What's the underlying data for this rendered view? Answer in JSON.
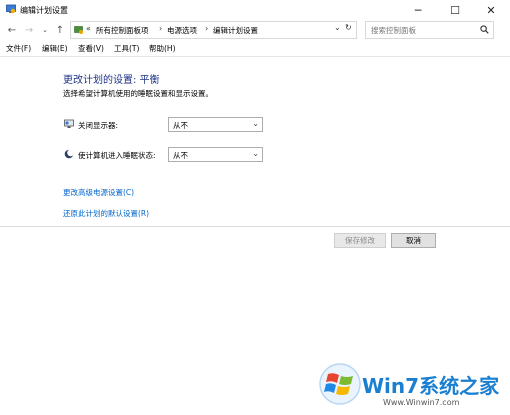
{
  "window": {
    "title": "编辑计划设置",
    "controls": [
      "minimize-icon",
      "maximize-icon",
      "close-icon"
    ]
  },
  "navigation": {
    "breadcrumbs": [
      "«",
      "所有控制面板项",
      "电源选项",
      "编辑计划设置"
    ],
    "search_placeholder": "搜索控制面板"
  },
  "menu": {
    "items": [
      "文件(F)",
      "编辑(E)",
      "查看(V)",
      "工具(T)",
      "帮助(H)"
    ]
  },
  "main": {
    "heading": "更改计划的设置: 平衡",
    "subtext": "选择希望计算机使用的睡眠设置和显示设置。",
    "settings": [
      {
        "label": "关闭显示器:",
        "icon": "monitor-icon",
        "value": "从不"
      },
      {
        "label": "使计算机进入睡眠状态:",
        "icon": "sleep-moon-icon",
        "value": "从不"
      }
    ],
    "links": {
      "advanced": "更改高级电源设置(C)",
      "restore": "还原此计划的默认设置(R)"
    },
    "buttons": {
      "save": "保存修改",
      "cancel": "取消"
    }
  },
  "watermark": {
    "brand": "Win7系统之家",
    "url": "Www.Winwin7.com"
  },
  "colors": {
    "heading": "#1e3287",
    "link": "#0066cc",
    "watermark": "#1a7fd0"
  }
}
